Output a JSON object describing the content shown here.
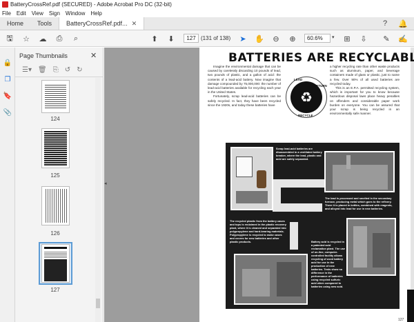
{
  "window": {
    "title": "BatteryCrossRef.pdf (SECURED) - Adobe Acrobat Pro DC (32-bit)"
  },
  "menu": [
    "File",
    "Edit",
    "View",
    "Sign",
    "Window",
    "Help"
  ],
  "tabs": {
    "home": "Home",
    "tools": "Tools",
    "document": "BatteryCrossRef.pdf..."
  },
  "toolbar": {
    "page_current": "127",
    "page_info": "(131 of 138)",
    "zoom": "60.6%"
  },
  "panel": {
    "title": "Page Thumbnails",
    "thumbnails": [
      {
        "label": "124"
      },
      {
        "label": "125"
      },
      {
        "label": "126"
      },
      {
        "label": "127",
        "selected": true
      }
    ]
  },
  "document": {
    "heading": "BATTERIES ARE RECYCLABLE!",
    "col1": "Imagine the environmental damage that can be caused by carelessly discarding 10 pounds of lead, two pounds of plastic, and a gallon of acid: the contents of a lead-acid battery. Now imagine that damage compounded by 75,000,000: the number of lead-acid batteries available for recycling each year in the United States.",
    "col1b": "Fortunately, scrap lead-acid batteries can be safely recycled. In fact, they have been recycled since the 1920s, and today these batteries have",
    "col2": "a higher recycling rate than other waste products such as aluminum, paper, and beverage containers made of glass or plastic, just to name a few. Over 90% of all used batteries are recycled today.",
    "col2b": "This is an E.P.A. permitted recycling system, which is important for you to know because hazardous disposal laws place heavy penalties on offenders and considerable paper work burden on everyone. You can be assured that your scrap is being recycled in an environmentally safe manner.",
    "logo": {
      "top": "LEAD",
      "right": "RETURN",
      "bottom": "RECYCLE",
      "symbol": "♻"
    },
    "diagram": {
      "step1": "Scrap lead-acid batteries are disassembled in a ventilated battery breaker, where the lead, plastic and acid are safely separated.",
      "step2": "The lead is processed and smelted in the secondary furnace, producing metal which goes to the refinery. There it is placed in kettles, combined with reagents, and alloyed into lead for use in new batteries.",
      "step3": "The recycled plastic from the battery cases and tops is reclaimed in the plastic recovery plant, where it is cleaned and separated into polypropylene and hard-bearing materials. Polypropylene is recycled to make cases and covers for new batteries and other plastic products.",
      "step4": "Battery acid is recycled in a patented acid reclamation plant. The use of on-line, computer-controlled facility allows recycling of used battery acid for use in the production of new batteries. Tests show no difference in the performance of batteries using recycled sulfuric acid when compared to batteries using new acid."
    },
    "page_number": "127"
  }
}
